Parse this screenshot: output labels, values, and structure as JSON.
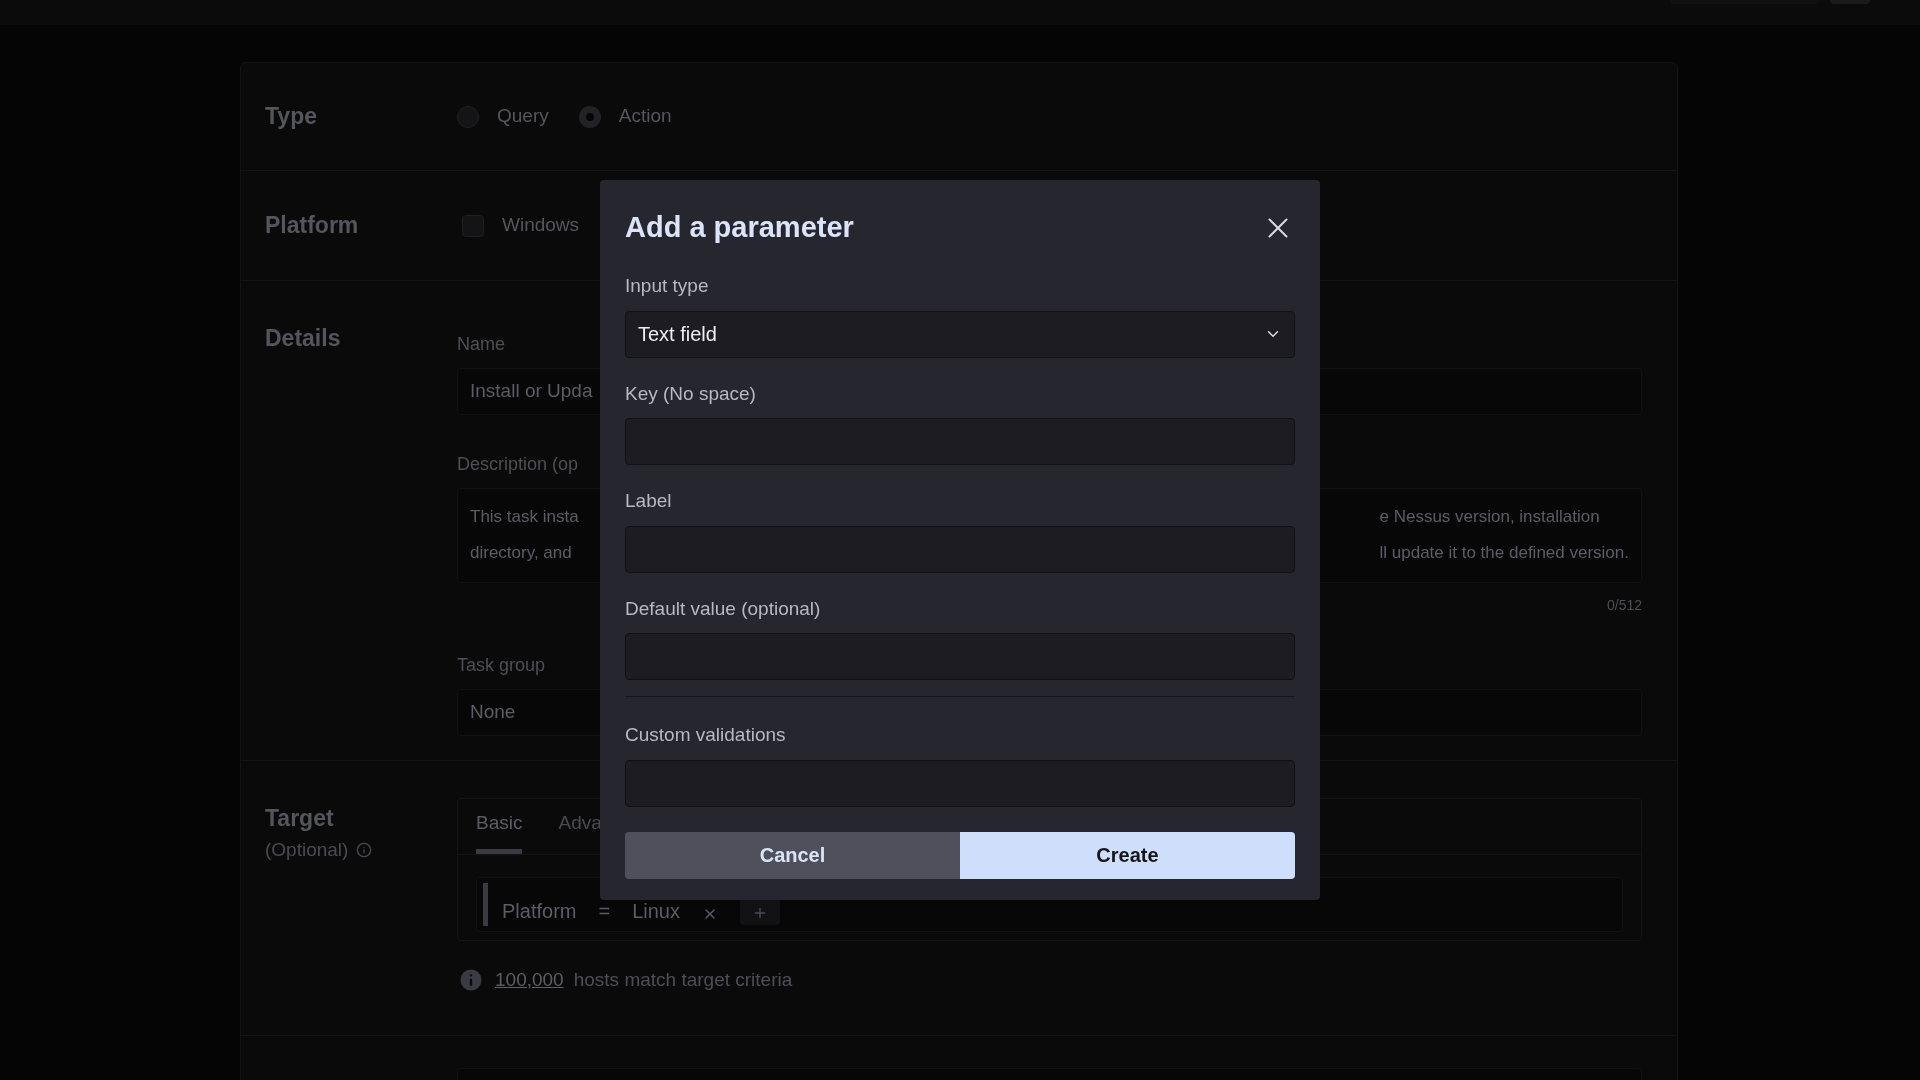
{
  "page": {
    "type_section": {
      "title": "Type",
      "options": [
        {
          "label": "Query",
          "selected": false
        },
        {
          "label": "Action",
          "selected": true
        }
      ]
    },
    "platform_section": {
      "title": "Platform",
      "options": [
        {
          "label": "Windows",
          "checked": false
        }
      ]
    },
    "details_section": {
      "title": "Details",
      "name": {
        "label": "Name",
        "value": "Install or Upda"
      },
      "description": {
        "label": "Description (op",
        "lines_left": [
          "This task insta",
          "directory, and"
        ],
        "lines_right": [
          "e Nessus version, installation",
          "ll update it to the defined version."
        ],
        "counter": "0/512"
      },
      "task_group": {
        "label": "Task group",
        "value": "None"
      }
    },
    "target_section": {
      "title": "Target",
      "subtitle": "(Optional)",
      "tabs": [
        {
          "label": "Basic",
          "selected": true
        },
        {
          "label": "Adva",
          "selected": false
        }
      ],
      "chips": [
        {
          "field": "Platform",
          "operator": "=",
          "value": "Linux"
        }
      ],
      "match": {
        "count": "100,000",
        "text": "hosts match target criteria"
      }
    }
  },
  "dialog": {
    "title": "Add a parameter",
    "fields": [
      {
        "label": "Input type",
        "kind": "select",
        "value": "Text field",
        "divider_before": false
      },
      {
        "label": "Key (No space)",
        "kind": "text",
        "divider_before": false
      },
      {
        "label": "Label",
        "kind": "text",
        "divider_before": false
      },
      {
        "label": "Default value (optional)",
        "kind": "text",
        "divider_before": false
      },
      {
        "label": "Custom validations",
        "kind": "text",
        "divider_before": true
      }
    ],
    "buttons": [
      {
        "label": "Cancel",
        "kind": "secondary"
      },
      {
        "label": "Create",
        "kind": "primary"
      }
    ]
  }
}
